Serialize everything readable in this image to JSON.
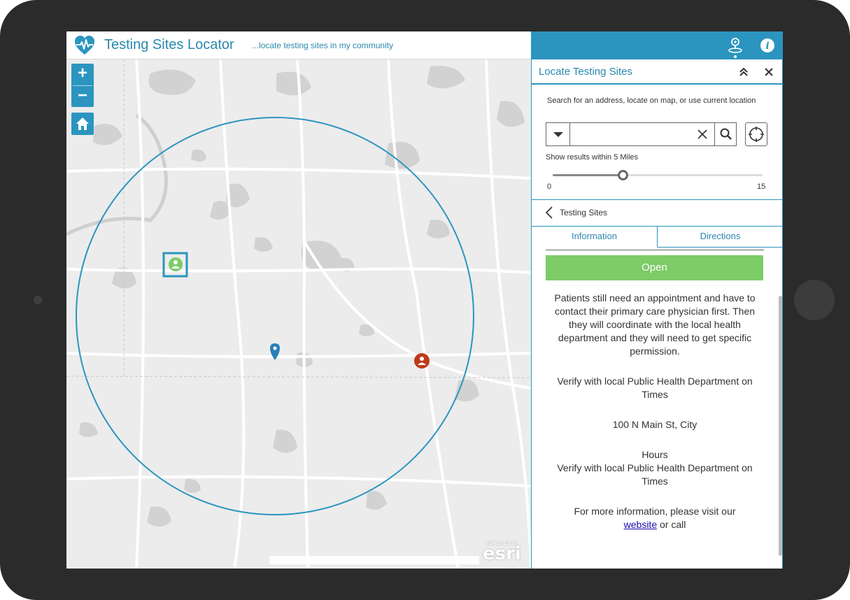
{
  "header": {
    "title": "Testing Sites Locator",
    "subtitle": "...locate testing sites in my community",
    "logo_icon": "heart-pulse-icon"
  },
  "topbar": {
    "icons": [
      "location-pin-icon",
      "info-icon"
    ]
  },
  "map": {
    "zoom_in_label": "+",
    "zoom_out_label": "−",
    "home_icon": "home-icon",
    "esri_small": "POWERED BY",
    "esri_big": "esri",
    "markers": [
      "testing-site-open-marker",
      "search-location-marker",
      "testing-site-closed-marker"
    ],
    "buffer": "search-radius-circle"
  },
  "panel": {
    "title": "Locate Testing Sites",
    "collapse_icon": "double-chevron-up-icon",
    "close_icon": "close-icon",
    "search_label": "Search for an address, locate on map, or use current location",
    "search_value": "",
    "search_placeholder": "",
    "radius_label": "Show results within 5 Miles",
    "slider": {
      "min": "0",
      "max": "15",
      "value": 5
    },
    "back_label": "Testing Sites",
    "tabs": {
      "information": "Information",
      "directions": "Directions"
    },
    "status": "Open",
    "status_color": "#7dcb69",
    "paragraph1": "Patients still need an appointment and have to contact their primary care physician first. Then they will coordinate with the local health department and they will need to get specific permission.",
    "paragraph2": "Verify with local Public Health Department on Times",
    "address": "100 N Main St, City",
    "hours_label": "Hours",
    "hours_value": "Verify with local Public Health Department on Times",
    "more_info_prefix": "For more information, please visit our",
    "website_link": "website",
    "more_info_suffix": "or call"
  },
  "colors": {
    "accent": "#2b95bf",
    "open": "#7dcb69",
    "closed": "#c0391b"
  }
}
